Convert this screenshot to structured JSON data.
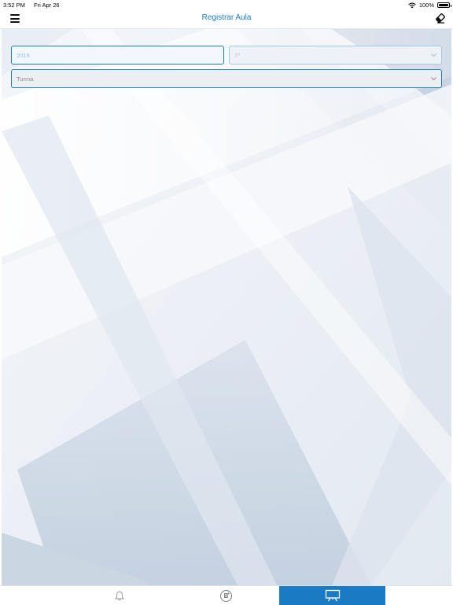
{
  "status_bar": {
    "time": "3:52 PM",
    "date": "Fri Apr 26",
    "battery": "100%"
  },
  "nav": {
    "title": "Registrar Aula",
    "left_icon": "hamburger-menu-icon",
    "right_icon": "eraser-icon"
  },
  "form": {
    "year": {
      "value": "2019"
    },
    "period": {
      "value": "1º"
    },
    "turma": {
      "placeholder": "Turma"
    }
  },
  "tabbar": {
    "tabs": [
      {
        "icon": "bell-icon",
        "active": false
      },
      {
        "icon": "boletim-b-icon",
        "label": "B",
        "active": false
      },
      {
        "icon": "presentation-board-icon",
        "active": true
      }
    ]
  },
  "colors": {
    "accent": "#1a7bc4",
    "background": "#eef2f7"
  }
}
